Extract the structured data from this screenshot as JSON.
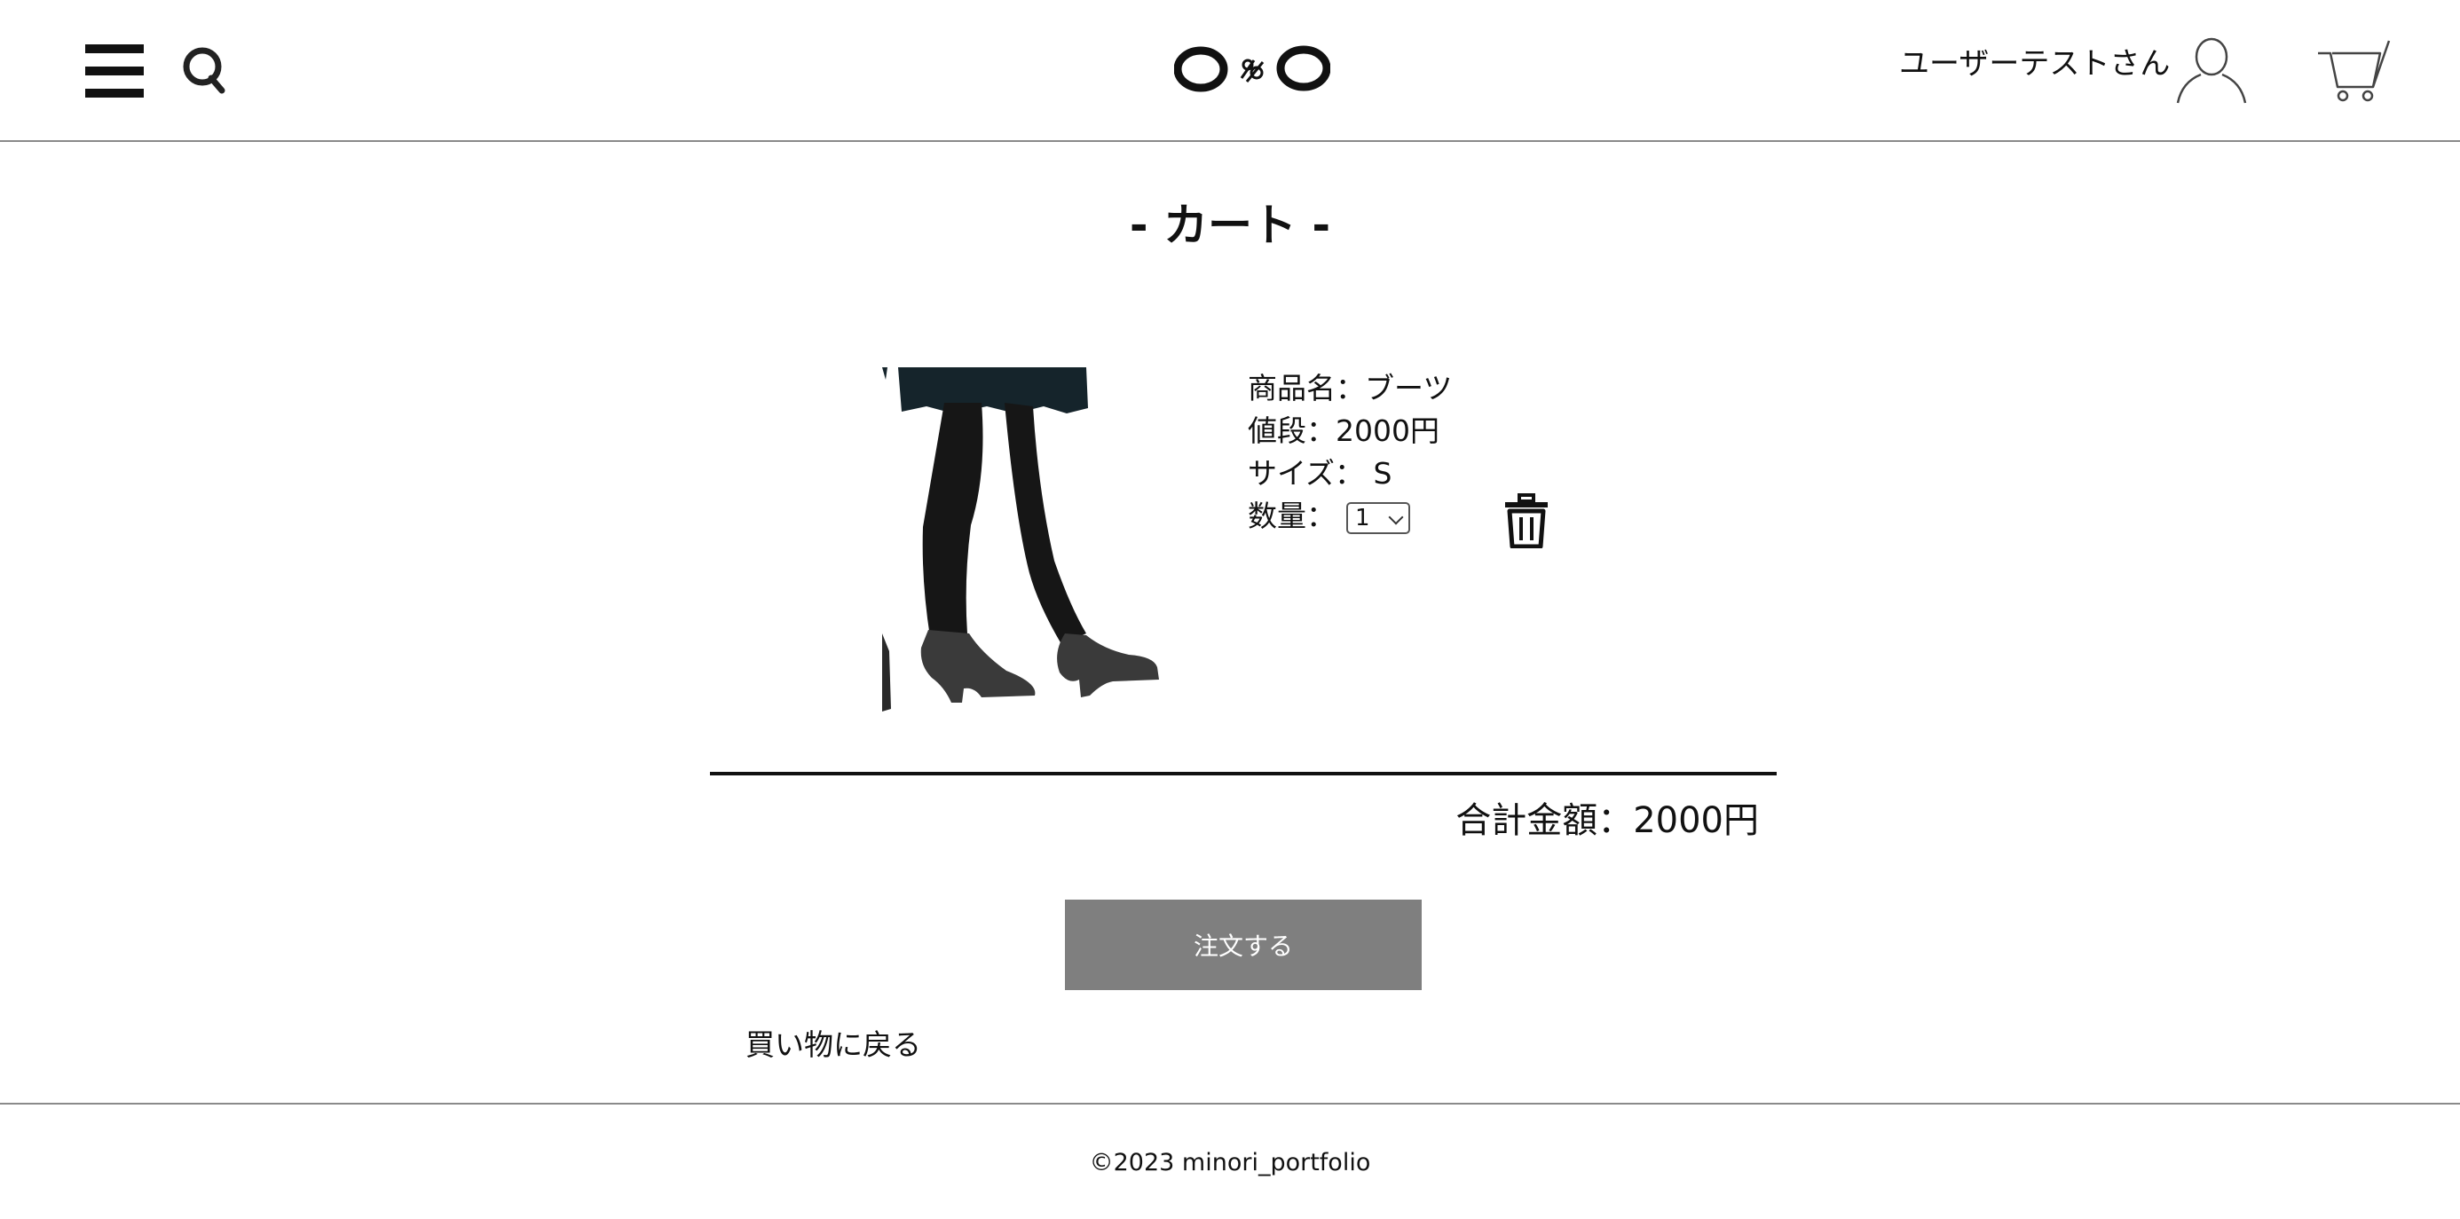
{
  "header": {
    "user_name": "ユーザーテストさん",
    "icons": [
      "menu-icon",
      "search-icon",
      "logo",
      "user-icon",
      "cart-icon"
    ]
  },
  "page_title": "- カート -",
  "cart": {
    "items": [
      {
        "name_label": "商品名：ブーツ",
        "price_label": "値段：2000円",
        "size_label": "サイズ： S",
        "quantity_label": "数量：",
        "quantity_value": "1",
        "image": "boots-legs-illustration"
      }
    ],
    "total_label": "合計金額：2000円"
  },
  "actions": {
    "order_label": "注文する",
    "back_label": "買い物に戻る"
  },
  "footer": {
    "copyright": "©2023 minori_portfolio"
  },
  "colors": {
    "order_button_bg": "#7f7f7f",
    "divider": "#111111",
    "skirt": "#15242b",
    "boots": "#3a3a3a"
  }
}
